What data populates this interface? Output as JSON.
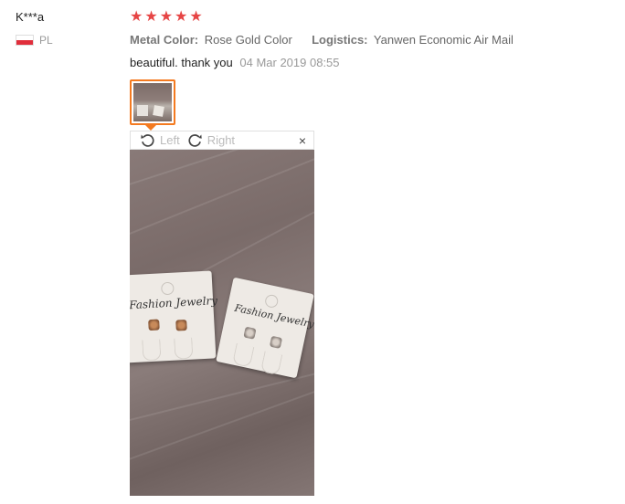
{
  "review": {
    "user": "K***a",
    "country_code": "PL",
    "rating_stars": 5,
    "meta": {
      "color_key": "Metal Color:",
      "color_value": "Rose Gold Color",
      "logistics_key": "Logistics:",
      "logistics_value": "Yanwen Economic Air Mail"
    },
    "text": "beautiful. thank you",
    "time": "04 Mar 2019 08:55"
  },
  "viewer": {
    "rotate_left": "Left",
    "rotate_right": "Right",
    "close": "×"
  },
  "photo": {
    "card1_text": "Fashion Jewelry",
    "card2_text": "Fashion Jewelry"
  },
  "colors": {
    "star": "#e64545",
    "accent": "#f47a20"
  },
  "icons": {
    "rotate_left": "rotate-left-icon",
    "rotate_right": "rotate-right-icon",
    "close": "close-icon"
  }
}
